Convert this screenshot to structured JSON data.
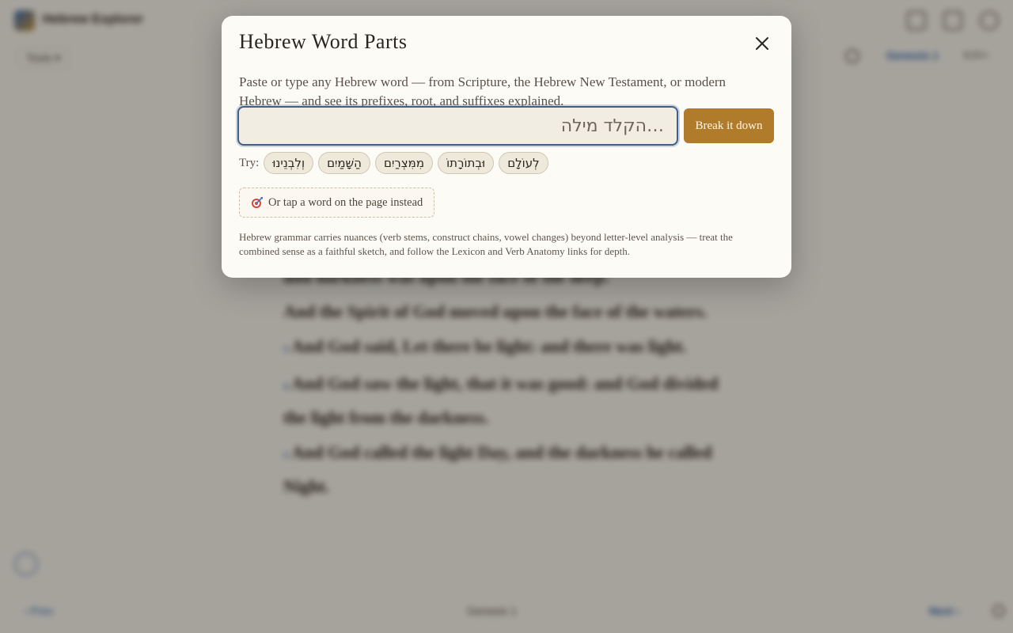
{
  "app": {
    "title": "Hebrew Explorer",
    "tools_label": "Tools ▾",
    "book_selector": "Genesis 1",
    "version_selector": "KJV+",
    "prev_label": "‹ Prev",
    "chapter_selector": "Genesis 1",
    "next_label": "Next ›"
  },
  "reader": {
    "lines": [
      "and darkness was upon the face of the deep.",
      "And the Spirit of God moved upon the face of the waters.",
      "And God said, Let there be light: and there was light.",
      "And God saw the light, that it was good: and God divided the light from the darkness.",
      "And God called the light Day, and the darkness he called Night."
    ],
    "verse_numbers": [
      "3",
      "4",
      "5"
    ]
  },
  "modal": {
    "title": "Hebrew Word Parts",
    "description": "Paste or type any Hebrew word — from Scripture, the Hebrew New Testament, or modern Hebrew — and see its prefixes, root, and suffixes explained.",
    "input_placeholder": "…הקלד מילה",
    "input_value": "",
    "submit_label": "Break it down",
    "try_label": "Try:",
    "examples": [
      "וְלִבְנֵינוּ",
      "הַשָּׁמַיִם",
      "מִמִּצְרַיִם",
      "וּבְתוֹרָתוֹ",
      "לְעוֹלָם"
    ],
    "tap_label": "Or tap a word on the page instead",
    "note": "Hebrew grammar carries nuances (verb stems, construct chains, vowel changes) beyond letter-level analysis — treat the combined sense as a faithful sketch, and follow the Lexicon and Verb Anatomy links for depth."
  },
  "icons": {
    "close": "close-icon",
    "target": "target-icon"
  },
  "colors": {
    "accent": "#b07c2c",
    "input_border": "#3f5f8c",
    "modal_bg": "#fdfbf6"
  }
}
